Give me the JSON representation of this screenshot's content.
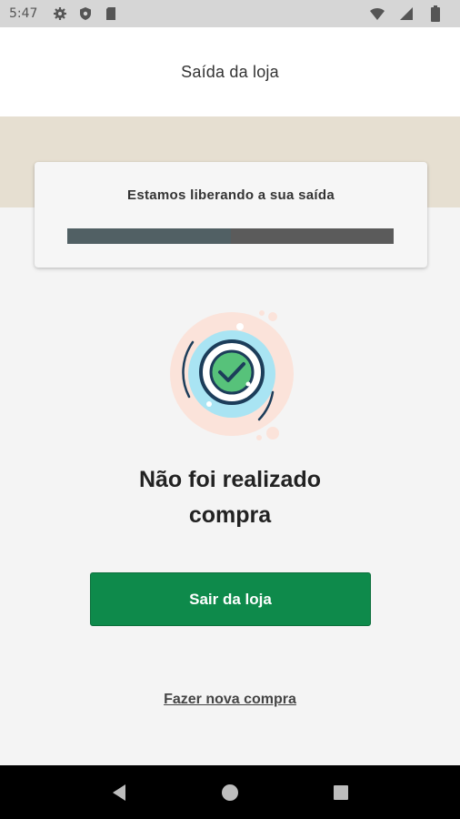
{
  "status_bar": {
    "time": "5:47",
    "left_icons": [
      "settings-icon",
      "shield-icon",
      "sd-card-icon"
    ],
    "right_icons": [
      "wifi-icon",
      "signal-icon",
      "battery-icon"
    ]
  },
  "header": {
    "title": "Saída da loja"
  },
  "card": {
    "title": "Estamos liberando a sua saída",
    "progress_percent": 0.5
  },
  "illustration": {
    "icon": "check-circle-icon"
  },
  "message": {
    "line1": "Não foi realizado",
    "line2": "compra"
  },
  "actions": {
    "primary_label": "Sair da loja",
    "secondary_label": "Fazer nova compra"
  },
  "nav": {
    "buttons": [
      "back-icon",
      "home-icon",
      "recents-icon"
    ]
  },
  "colors": {
    "primary": "#0e8a4b",
    "band": "#e6dfd1",
    "progress_track": "#5b5b5b",
    "progress_fill": "#516064"
  }
}
